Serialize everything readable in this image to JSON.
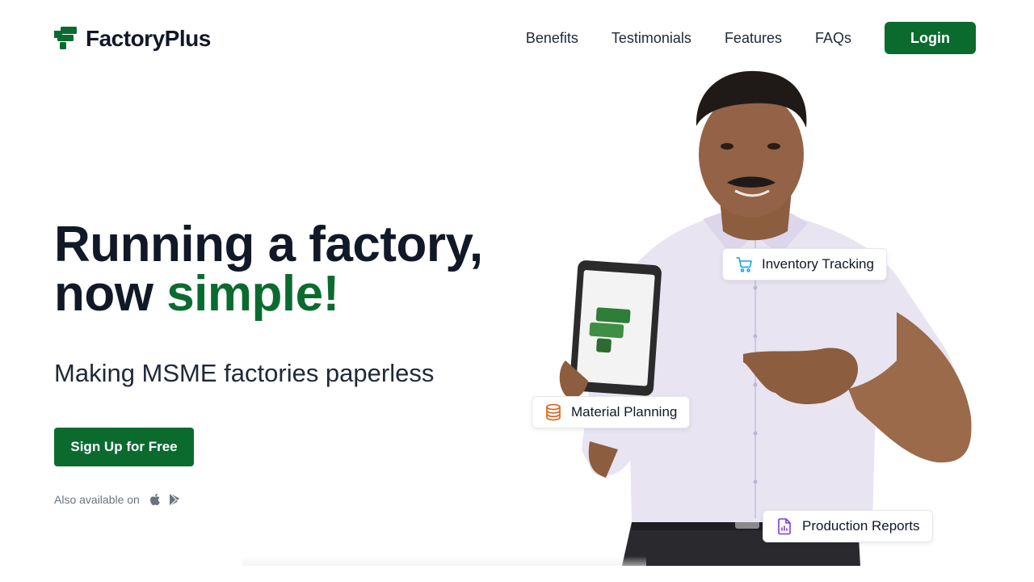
{
  "brand": {
    "name": "FactoryPlus",
    "color": "#0b6b2f"
  },
  "nav": {
    "links": [
      "Benefits",
      "Testimonials",
      "Features",
      "FAQs"
    ],
    "login_label": "Login"
  },
  "hero": {
    "headline_line1": "Running a factory,",
    "headline_now": "now ",
    "headline_accent": "simple!",
    "subheading": "Making MSME factories paperless",
    "cta_label": "Sign Up for Free",
    "available_text": "Also available on",
    "store_icons": [
      "apple-icon",
      "google-play-icon"
    ]
  },
  "features": [
    {
      "label": "Inventory Tracking",
      "icon": "cart-icon",
      "color": "#0ea5e9"
    },
    {
      "label": "Material Planning",
      "icon": "database-icon",
      "color": "#ea580c"
    },
    {
      "label": "Production Reports",
      "icon": "report-icon",
      "color": "#7c3aed"
    }
  ]
}
